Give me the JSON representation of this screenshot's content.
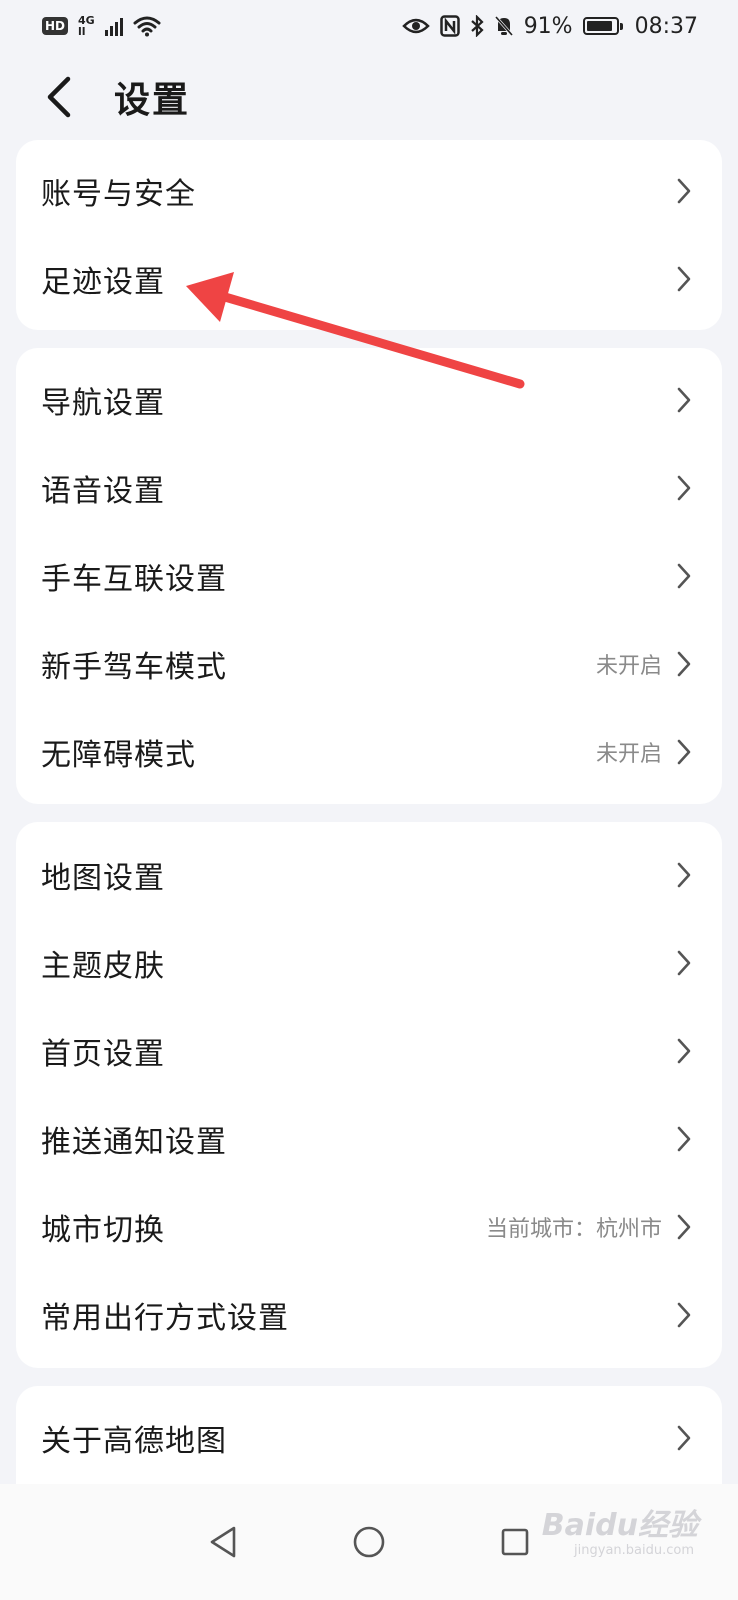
{
  "status_bar": {
    "hd": "HD",
    "net_type_top": "4G",
    "net_type_bottom": "ll",
    "battery_percent": "91%",
    "battery_level": 0.91,
    "time": "08:37"
  },
  "header": {
    "title": "设置"
  },
  "groups": [
    {
      "items": [
        {
          "label": "账号与安全",
          "value": ""
        },
        {
          "label": "足迹设置",
          "value": ""
        }
      ]
    },
    {
      "items": [
        {
          "label": "导航设置",
          "value": ""
        },
        {
          "label": "语音设置",
          "value": ""
        },
        {
          "label": "手车互联设置",
          "value": ""
        },
        {
          "label": "新手驾车模式",
          "value": "未开启"
        },
        {
          "label": "无障碍模式",
          "value": "未开启"
        }
      ]
    },
    {
      "items": [
        {
          "label": "地图设置",
          "value": ""
        },
        {
          "label": "主题皮肤",
          "value": ""
        },
        {
          "label": "首页设置",
          "value": ""
        },
        {
          "label": "推送通知设置",
          "value": ""
        },
        {
          "label": "城市切换",
          "value": "当前城市：杭州市"
        },
        {
          "label": "常用出行方式设置",
          "value": ""
        }
      ]
    },
    {
      "items": [
        {
          "label": "关于高德地图",
          "value": ""
        }
      ]
    }
  ],
  "watermark": {
    "text": "Baidu经验",
    "sub": "jingyan.baidu.com"
  },
  "colors": {
    "annotation_arrow": "#ef4444",
    "background": "#f3f4f8",
    "card": "#ffffff",
    "secondary_text": "#8a8a8a"
  },
  "icons": {
    "back": "chevron-left-icon",
    "row": "chevron-right-icon",
    "nav": [
      "back-triangle-icon",
      "home-circle-icon",
      "recents-square-icon"
    ]
  }
}
